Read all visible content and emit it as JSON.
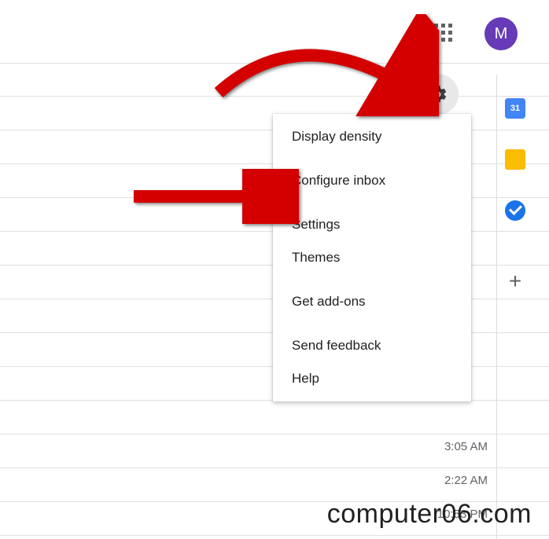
{
  "avatar": {
    "initial": "M"
  },
  "side_calendar": {
    "label": "31"
  },
  "menu": {
    "items": [
      "Display density",
      "Configure inbox",
      "Settings",
      "Themes",
      "Get add-ons",
      "Send feedback",
      "Help"
    ]
  },
  "timestamps": [
    "3:05 AM",
    "2:22 AM",
    "10:53 PM"
  ],
  "watermark": "computer06.com"
}
